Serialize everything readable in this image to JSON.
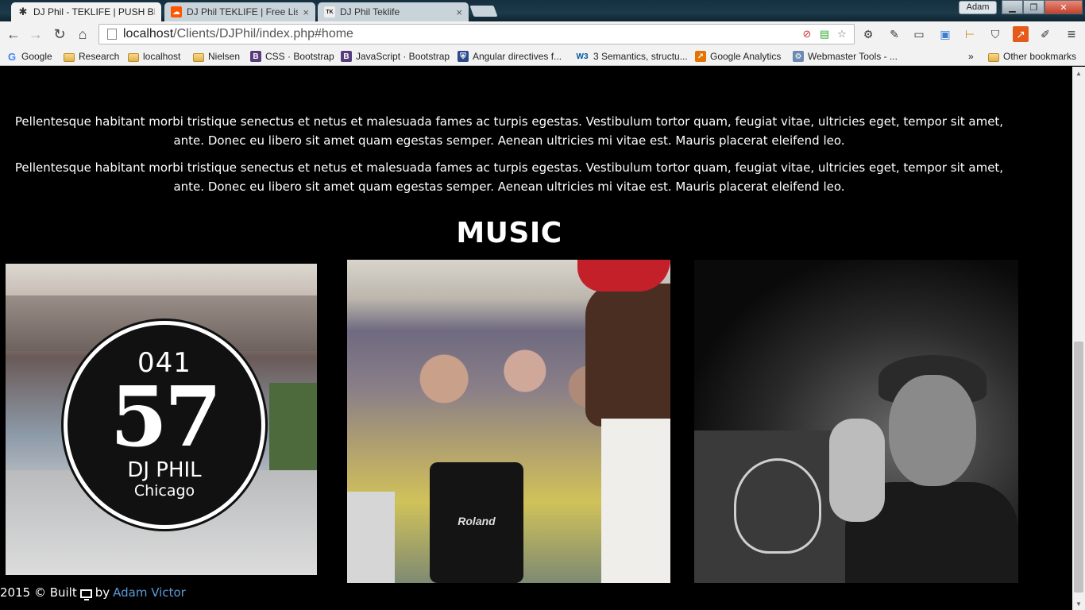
{
  "browser": {
    "tabs": [
      {
        "title": "DJ Phil - TEKLIFE | PUSH BI",
        "active": true,
        "icon": "gear-icon"
      },
      {
        "title": "DJ Phil TEKLIFE | Free Liste",
        "active": false,
        "icon": "soundcloud-icon"
      },
      {
        "title": "DJ Phil Teklife",
        "active": false,
        "icon": "teklife-icon"
      }
    ],
    "tab_close_glyph": "×",
    "user": "Adam",
    "url_host": "localhost",
    "url_path": "/Clients/DJPhil/index.php#home",
    "bookmarks": [
      {
        "label": "Google",
        "icon": "google-icon"
      },
      {
        "label": "Research",
        "icon": "folder-icon"
      },
      {
        "label": "localhost",
        "icon": "folder-icon"
      },
      {
        "label": "Nielsen",
        "icon": "folder-icon"
      },
      {
        "label": "CSS · Bootstrap",
        "icon": "bootstrap-icon"
      },
      {
        "label": "JavaScript · Bootstrap",
        "icon": "bootstrap-icon"
      },
      {
        "label": "Angular directives f...",
        "icon": "angular-icon"
      },
      {
        "label": "3 Semantics, structu...",
        "icon": "w3c-icon"
      },
      {
        "label": "Google Analytics",
        "icon": "analytics-icon"
      },
      {
        "label": "Webmaster Tools - ...",
        "icon": "webmaster-icon"
      }
    ],
    "bookmarks_overflow": "»",
    "other_bookmarks": "Other bookmarks"
  },
  "page": {
    "paragraph_1": "Pellentesque habitant morbi tristique senectus et netus et malesuada fames ac turpis egestas. Vestibulum tortor quam, feugiat vitae, ultricies eget, tempor sit amet, ante. Donec eu libero sit amet quam egestas semper. Aenean ultricies mi vitae est. Mauris placerat eleifend leo.",
    "paragraph_2": "Pellentesque habitant morbi tristique senectus et netus et malesuada fames ac turpis egestas. Vestibulum tortor quam, feugiat vitae, ultricies eget, tempor sit amet, ante. Donec eu libero sit amet quam egestas semper. Aenean ultricies mi vitae est. Mauris placerat eleifend leo.",
    "music_heading": "MUSIC",
    "albums": [
      {
        "number": "041",
        "big": "57",
        "name": "DJ PHIL",
        "city": "Chicago"
      },
      {
        "speaker_brand": "Roland"
      },
      {}
    ],
    "footer": {
      "prefix": "2015 © Built",
      "by": "by",
      "author": "Adam Victor"
    }
  }
}
